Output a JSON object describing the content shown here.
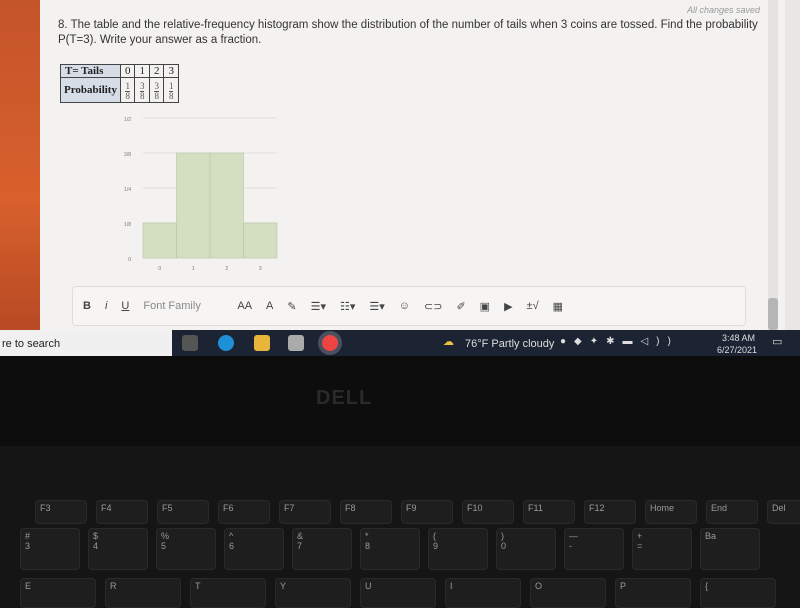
{
  "page": {
    "status": "All changes saved",
    "question": "8. The table and the relative-frequency histogram show the distribution of the number of tails when 3 coins are tossed.  Find the probability P(T=3).  Write your answer as a fraction."
  },
  "table": {
    "row1_header": "T= Tails",
    "row2_header": "Probability",
    "values": [
      "0",
      "1",
      "2",
      "3"
    ],
    "probs": [
      {
        "n": "1",
        "d": "8"
      },
      {
        "n": "3",
        "d": "8"
      },
      {
        "n": "3",
        "d": "8"
      },
      {
        "n": "1",
        "d": "8"
      }
    ]
  },
  "chart_data": {
    "type": "bar",
    "categories": [
      "0",
      "1",
      "2",
      "3"
    ],
    "values": [
      0.125,
      0.375,
      0.375,
      0.125
    ],
    "y_ticks": [
      "0",
      "1/8",
      "1/4",
      "3/8",
      "1/2"
    ],
    "ylim": [
      0,
      0.5
    ],
    "grid": true,
    "bar_color": "#d3dfc0"
  },
  "toolbar": {
    "bold": "B",
    "italic": "i",
    "underline": "U",
    "font_family": "Font Family",
    "font_size": "AA",
    "math": "±√"
  },
  "taskbar": {
    "search": "re to search",
    "weather": "76°F  Partly cloudy",
    "time": "3:48 AM",
    "date": "6/27/2021"
  },
  "laptop": {
    "brand": "DELL",
    "fkeys": [
      "F3",
      "F4",
      "F5",
      "F6",
      "F7",
      "F8",
      "F9",
      "F10",
      "F11",
      "F12",
      "Home",
      "End",
      "Del"
    ],
    "numkeys": [
      "#\n3",
      "$\n4",
      "%\n5",
      "^\n6",
      "&\n7",
      "*\n8",
      "(\n9",
      ")\n0",
      "—\n-",
      "+\n=",
      "Ba"
    ],
    "letters": [
      "E",
      "R",
      "T",
      "Y",
      "U",
      "I",
      "O",
      "P",
      "{"
    ]
  }
}
